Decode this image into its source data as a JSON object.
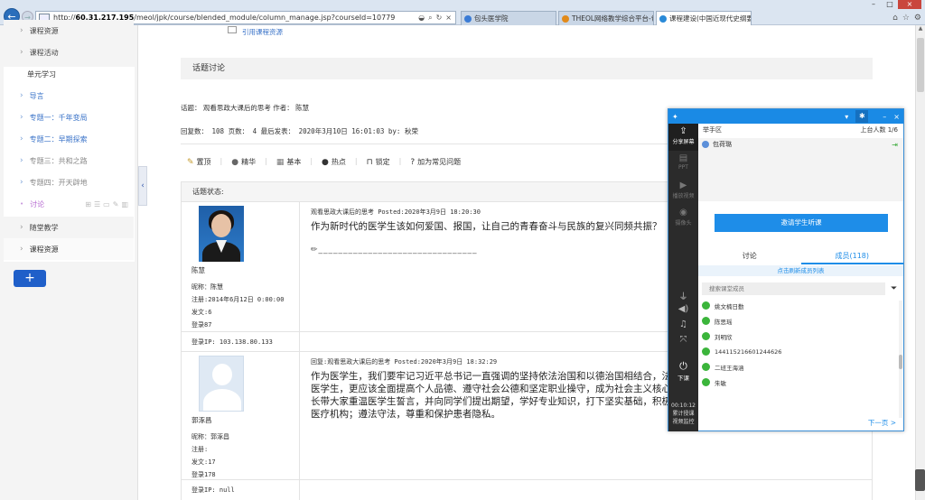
{
  "browser": {
    "url_prefix": "http://",
    "url_host": "60.31.217.195",
    "url_path": "/meol/jpk/course/blended_module/column_manage.jsp?courseId=10779",
    "tabs": [
      {
        "label": "包头医学院",
        "color": "#3a7bd5",
        "active": false
      },
      {
        "label": "THEOL网络教学综合平台-包...",
        "color": "#e28a1a",
        "active": false
      },
      {
        "label": "课程建设(中国近现代史纲要)",
        "color": "#2a8ad8",
        "active": true
      }
    ]
  },
  "sidebar": {
    "items": [
      {
        "label": "课程资源",
        "kind": "group"
      },
      {
        "label": "课程活动",
        "kind": "group"
      },
      {
        "label": "单元学习",
        "kind": "plain"
      },
      {
        "label": "导言",
        "kind": "sub"
      },
      {
        "label": "专题一：千年变局",
        "kind": "sub"
      },
      {
        "label": "专题二：早期探索",
        "kind": "sub"
      },
      {
        "label": "专题三：共和之路",
        "kind": "sub-gray"
      },
      {
        "label": "专题四：开天辟地",
        "kind": "sub-gray"
      },
      {
        "label": "讨论",
        "kind": "active"
      },
      {
        "label": "随堂教学",
        "kind": "group"
      },
      {
        "label": "课程资源",
        "kind": "group2"
      }
    ],
    "add_label": "+"
  },
  "main": {
    "topbar_link": "引用课程资源",
    "section_title": "话题讨论",
    "topic_line": "话题： 观看思政大课后的思考 作者： 陈慧",
    "meta_line": "回复数： 108  页数： 4  最后发表： 2020年3月10日 16:01:03  by: 秋荣",
    "actions": [
      {
        "icon": "✎",
        "label": "置顶"
      },
      {
        "icon": "●",
        "label": "精华"
      },
      {
        "icon": "▦",
        "label": "基本"
      },
      {
        "icon": "●",
        "label": "热点"
      },
      {
        "icon": "🔒",
        "label": "锁定"
      },
      {
        "icon": "?",
        "label": "加为常见问题"
      }
    ],
    "status_label": "话题状态:",
    "posts": [
      {
        "name": "陈慧",
        "nick": "昵称：陈慧",
        "reg": "注册:2014年6月12日 0:00:00",
        "posts": "发文:6",
        "logins": "登录87",
        "ip": "登录IP: 103.138.80.133",
        "title": "观看思政大课后的思考 Posted:2020年3月9日 18:20:30",
        "text": "作为新时代的医学生该如何爱国、报国，让自己的青春奋斗与民族的复兴同频共振？",
        "sig": "✏________________________________"
      },
      {
        "name": "郭涿昌",
        "nick": "昵称：郭涿昌",
        "reg": "注册:",
        "posts": "发文:17",
        "logins": "登录178",
        "ip": "登录IP: null",
        "title": "回复:观看思政大课后的思考 Posted:2020年3月9日 18:32:29",
        "text": "作为医学生，我们要牢记习近平总书记一直强调的坚持依法治国和以德治国相结合，法安天下，德润人心。作为医学生身为新时代的医学生，更应该全面提高个人品德、遵守社会公德和坚定职业操守，成为社会主义核心价值观的践行者，为社会贡献。讲课中，唐校长带大家重温医学生誓言，并向同学们提出期望，学好专业知识，打下坚实基础，积极参与志愿服务实践；响应国家号召，服务基层医疗机构；遵法守法，尊重和保护患者隐私。",
        "sig": ""
      }
    ]
  },
  "panel": {
    "left_tools": [
      {
        "icon": "⇪",
        "label": "分享屏幕",
        "active": true
      },
      {
        "icon": "▤",
        "label": "PPT",
        "active": false
      },
      {
        "icon": "▶",
        "label": "播放视频",
        "active": false
      },
      {
        "icon": "◉",
        "label": "摄像头",
        "active": false
      }
    ],
    "vol_icons": [
      "🎙",
      "🔊",
      "♫",
      "⤧"
    ],
    "end_label": "下课",
    "timer": "00:10:12",
    "timer_label": "累计授课",
    "quality_label": "视频监控",
    "raise_title": "举手区",
    "raise_count": "上台人数 1/6",
    "raise_user": "包荷璐",
    "invite_label": "邀请学生听课",
    "tab_discuss": "讨论",
    "tab_members": "成员(118)",
    "refresh_label": "点击刷新成员列表",
    "search_placeholder": "搜索课堂成员",
    "members": [
      "姚文楠日勤",
      "陈思瑶",
      "刘明欣",
      "144115216601244626",
      "二班王海涵",
      "朱敏"
    ],
    "next_label": "下一页 >"
  }
}
